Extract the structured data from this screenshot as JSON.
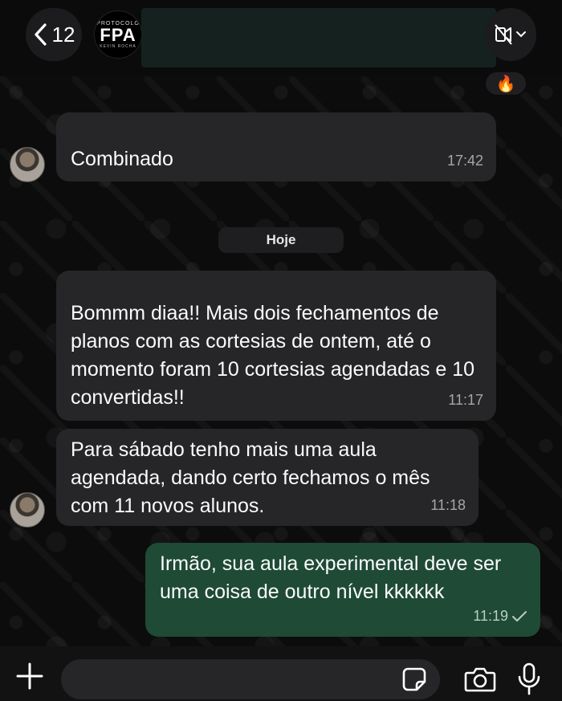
{
  "header": {
    "back_count": "12",
    "group_avatar": {
      "top_text": "PROTOCOLO",
      "logo_text": "FPA",
      "bottom_text": "KEVIN ROCHA"
    },
    "icons": {
      "back": "chevron-left-icon",
      "call": "video-call-icon",
      "dropdown": "chevron-down-icon"
    }
  },
  "messages": [
    {
      "text": "Combinado",
      "time": "17:42",
      "direction": "in",
      "reaction": "🔥"
    },
    {
      "text": "Bommm diaa!! Mais dois fechamentos de planos com as cortesias de ontem, até o momento foram 10 cortesias agendadas e 10 convertidas!!",
      "time": "11:17",
      "direction": "in"
    },
    {
      "text": "Para sábado tenho mais uma aula agendada, dando certo fechamos o mês com 11 novos alunos.",
      "time": "11:18",
      "direction": "in"
    },
    {
      "text": "Irmão, sua aula experimental deve ser uma coisa de outro nível kkkkkk",
      "time": "11:19",
      "direction": "out",
      "status": "sent-check-icon"
    }
  ],
  "date_separator": "Hoje",
  "composer": {
    "placeholder": "",
    "icons": [
      "plus-icon",
      "sticker-icon",
      "camera-icon",
      "microphone-icon"
    ]
  },
  "colors": {
    "background": "#0b0b0b",
    "incoming_bubble": "#262628",
    "outgoing_bubble": "#1e4a36"
  }
}
